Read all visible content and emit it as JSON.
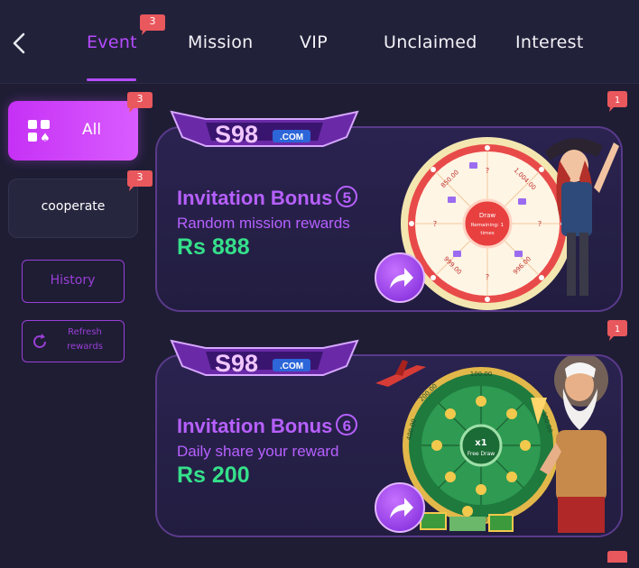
{
  "header": {
    "tabs": [
      {
        "label": "Event",
        "active": true,
        "badge": "3"
      },
      {
        "label": "Mission"
      },
      {
        "label": "VIP"
      },
      {
        "label": "Unclaimed"
      },
      {
        "label": "Interest"
      }
    ]
  },
  "sidebar": {
    "all": {
      "label": "All",
      "badge": "3"
    },
    "cooperate": {
      "label": "cooperate",
      "badge": "3"
    },
    "history": {
      "label": "History"
    },
    "refresh": {
      "label_line1": "Refresh",
      "label_line2": "rewards"
    }
  },
  "cards": [
    {
      "logo_main": "S98",
      "logo_dot": ".COM",
      "title": "Invitation Bonus",
      "number": "5",
      "subtitle": "Random mission rewards",
      "amount": "Rs 888",
      "corner_badge": "1",
      "wheel_center_line1": "Draw",
      "wheel_center_line2": "Remaining: 1",
      "wheel_center_line3": "times",
      "wheel_labels": [
        "?",
        "1,004.00",
        "?",
        "996.00",
        "?",
        "999.00",
        "?",
        "850.00"
      ]
    },
    {
      "logo_main": "S98",
      "logo_dot": ".COM",
      "title": "Invitation Bonus",
      "number": "6",
      "subtitle": "Daily share your reward",
      "amount": "Rs 200",
      "corner_badge": "1",
      "wheel_center_line1": "x1",
      "wheel_center_line2": "Free Draw",
      "wheel_labels": [
        "100.00",
        "300.00",
        "200.00",
        "400.00",
        "200.00"
      ]
    }
  ],
  "colors": {
    "background": "#1e1d34",
    "accent": "#b54bff",
    "badge": "#e8585d",
    "amount": "#35e08a"
  }
}
